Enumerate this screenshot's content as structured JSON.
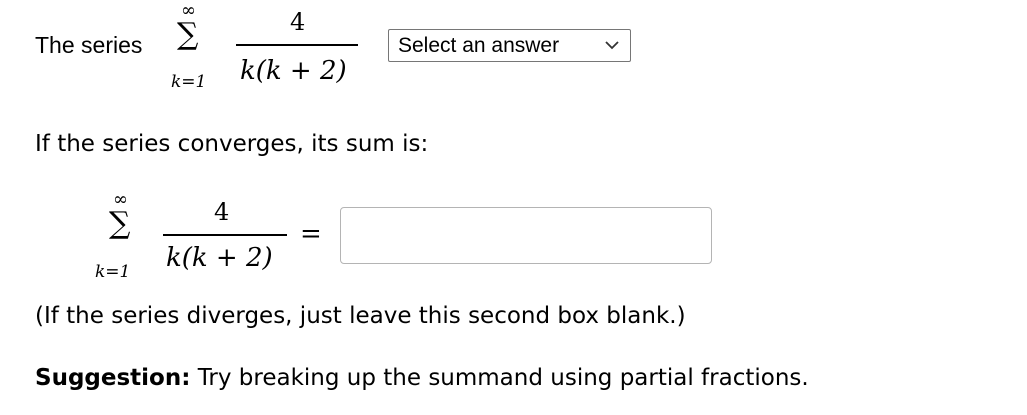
{
  "question": {
    "intro_label": "The series",
    "sum_upper": "∞",
    "sum_symbol": "∑",
    "sum_lower": "k=1",
    "numerator": "4",
    "denominator": "k(k + 2)",
    "select": {
      "selected_label": "Select an answer"
    },
    "converges_prompt": "If the series converges, its sum is:",
    "equals": "=",
    "answer_input_value": "",
    "diverge_note": "(If the series diverges, just leave this second box blank.)",
    "suggestion_label": "Suggestion:",
    "suggestion_text": " Try breaking up the summand using partial fractions."
  }
}
